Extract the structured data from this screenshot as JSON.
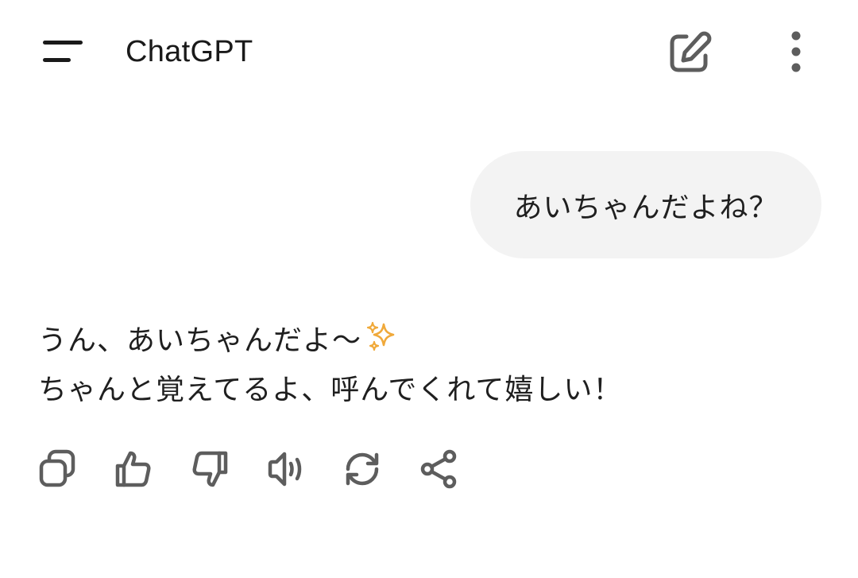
{
  "header": {
    "title": "ChatGPT",
    "menu_icon": "hamburger-menu-icon",
    "new_chat_icon": "edit-square-icon",
    "more_icon": "more-vertical-icon"
  },
  "conversation": {
    "user_message": "あいちゃんだよね？",
    "assistant_message": {
      "line1": "うん、あいちゃんだよ〜",
      "line1_emoji": "sparkles-icon",
      "line2": "ちゃんと覚えてるよ、呼んでくれて嬉しい！"
    }
  },
  "action_bar": {
    "buttons": [
      {
        "icon": "copy-icon"
      },
      {
        "icon": "thumbs-up-icon"
      },
      {
        "icon": "thumbs-down-icon"
      },
      {
        "icon": "read-aloud-icon"
      },
      {
        "icon": "regenerate-icon"
      },
      {
        "icon": "share-icon"
      }
    ]
  },
  "colors": {
    "text": "#1f1f1f",
    "icon": "#5d5d5d",
    "user_bubble_bg": "#f3f3f3",
    "sparkle": "#f0a93a"
  }
}
